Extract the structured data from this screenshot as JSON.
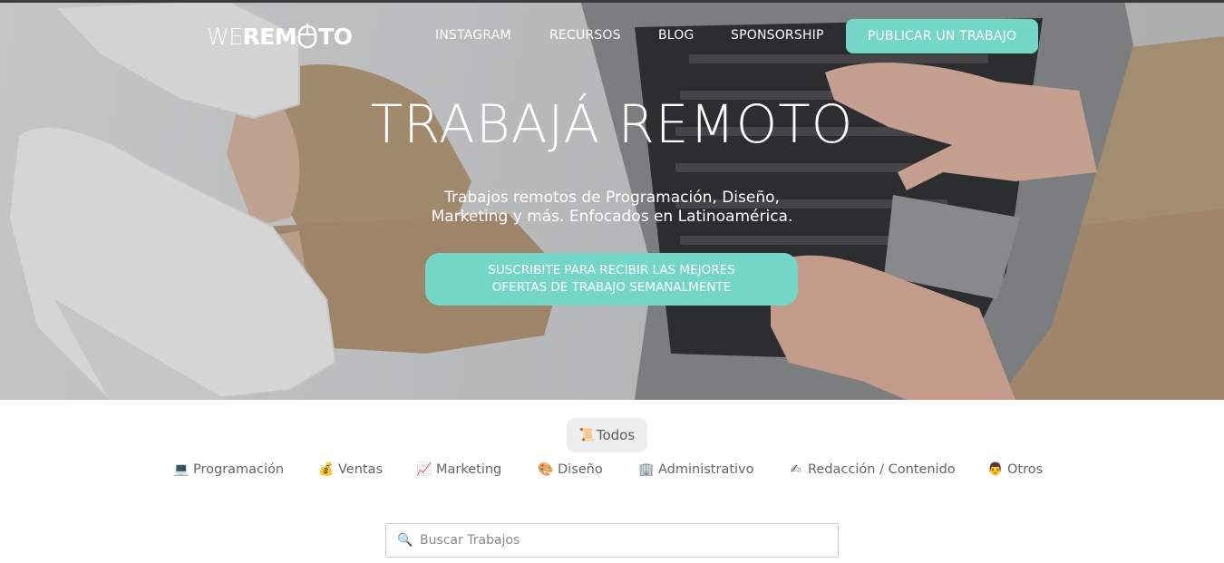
{
  "brand": {
    "logo_part1": "WE",
    "logo_part2": "REM",
    "logo_part3": "TO",
    "accent_color": "#74d6c6"
  },
  "nav": {
    "links": [
      "INSTAGRAM",
      "RECURSOS",
      "BLOG",
      "SPONSORSHIP"
    ],
    "cta": "PUBLICAR UN TRABAJO"
  },
  "hero": {
    "title": "TRABAJÁ REMOTO",
    "subtitle_line1": "Trabajos remotos de Programación, Diseño,",
    "subtitle_line2": "Marketing y más. Enfocados en Latinoamérica.",
    "cta_line1": "SUSCRIBITE PARA RECIBIR LAS MEJORES",
    "cta_line2": "OFERTAS DE TRABAJO SEMANALMENTE"
  },
  "filters": {
    "all": {
      "icon": "📜",
      "icon_name": "scroll-icon",
      "label": "Todos"
    },
    "categories": [
      {
        "icon": "💻",
        "icon_name": "laptop-icon",
        "label": "Programación"
      },
      {
        "icon": "💰",
        "icon_name": "money-bag-icon",
        "label": "Ventas"
      },
      {
        "icon": "📈",
        "icon_name": "chart-up-icon",
        "label": "Marketing"
      },
      {
        "icon": "🎨",
        "icon_name": "palette-icon",
        "label": "Diseño"
      },
      {
        "icon": "🏢",
        "icon_name": "office-building-icon",
        "label": "Administrativo"
      },
      {
        "icon": "✍",
        "icon_name": "writing-hand-icon",
        "label": "Redacción / Contenido"
      },
      {
        "icon": "👨",
        "icon_name": "person-icon",
        "label": "Otros"
      }
    ]
  },
  "search": {
    "icon": "🔍",
    "icon_name": "search-icon",
    "placeholder": "Buscar Trabajos",
    "value": ""
  }
}
